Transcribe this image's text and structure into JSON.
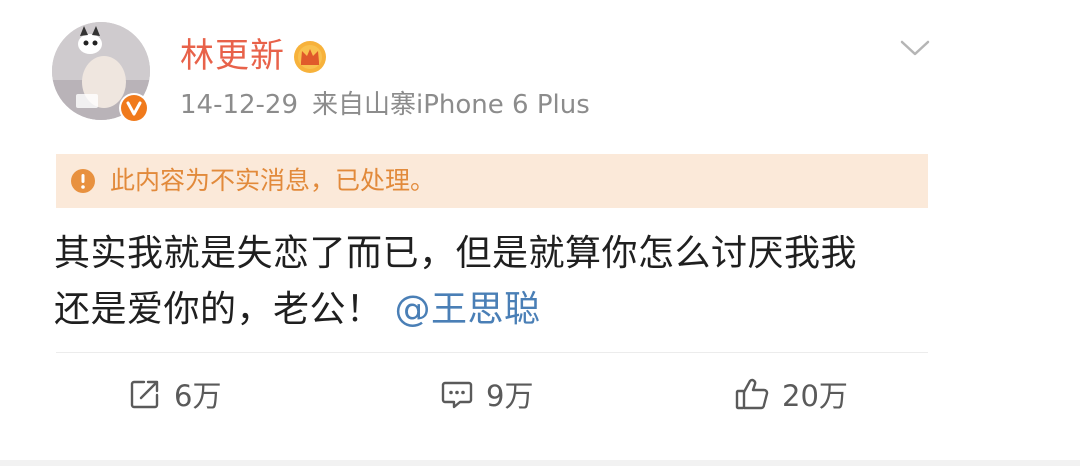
{
  "post": {
    "username": "林更新",
    "date": "14-12-29",
    "source": "来自山寨iPhone 6 Plus",
    "notice": "此内容为不实消息，已处理。",
    "text_line1": "其实我就是失恋了而已，但是就算你怎么讨厌我我",
    "text_line2": "还是爱你的，老公！",
    "mention": "@王思聪"
  },
  "actions": {
    "repost_count": "6万",
    "comment_count": "9万",
    "like_count": "20万"
  },
  "colors": {
    "username": "#e8624a",
    "notice_bg": "#fbe9d9",
    "notice_text": "#e28a3b",
    "mention": "#4a7fb6",
    "meta": "#8c8c8c",
    "verified_badge": "#f07a1c"
  },
  "icons": {
    "avatar": "avatar-image",
    "verified": "verified-v-icon",
    "vip": "vip-crown-icon",
    "more": "chevron-down-icon",
    "notice": "warning-circle-icon",
    "repost": "repost-icon",
    "comment": "comment-icon",
    "like": "thumbs-up-icon"
  }
}
